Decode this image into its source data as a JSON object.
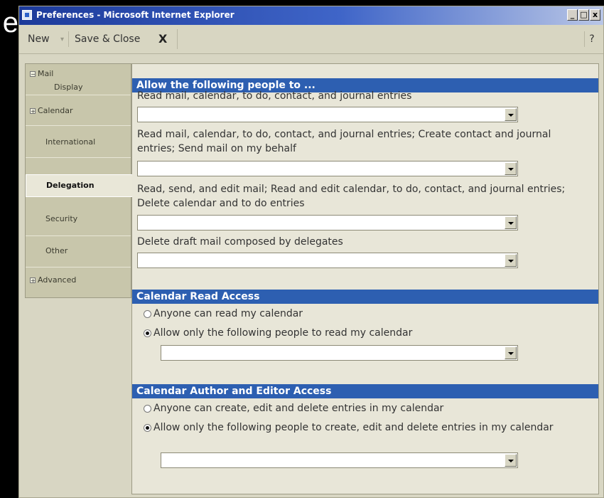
{
  "background_letter": "e",
  "window": {
    "title": "Preferences - Microsoft Internet Explorer",
    "controls": {
      "minimize": "_",
      "maximize": "□",
      "close": "x"
    }
  },
  "toolbar": {
    "new_label": "New",
    "new_arrow": "▾",
    "save_close_label": "Save & Close",
    "close_glyph": "X",
    "help_label": "?"
  },
  "nav": {
    "items": [
      {
        "label": "Mail",
        "toggle": "−"
      },
      {
        "label": "Display"
      },
      {
        "label": "Calendar",
        "toggle": "+"
      },
      {
        "label": "International"
      },
      {
        "label": "Delegation",
        "active": true
      },
      {
        "label": "Security"
      },
      {
        "label": "Other"
      },
      {
        "label": "Advanced",
        "toggle": "+"
      }
    ]
  },
  "delegates": {
    "header": "Allow the following people to ...",
    "perm1": "Read mail, calendar, to do, contact, and journal entries",
    "perm2": "Read mail, calendar, to do, contact, and journal entries; Create contact and journal entries; Send mail on my behalf",
    "perm3": "Read, send, and edit mail; Read and edit calendar, to do, contact, and journal entries; Delete calendar and to do entries",
    "perm4": "Delete draft mail composed by delegates",
    "dropdown1_value": "",
    "dropdown2_value": "",
    "dropdown3_value": "",
    "dropdown4_value": ""
  },
  "calendar_read": {
    "header": "Calendar Read Access",
    "option_anyone": "Anyone can read my calendar",
    "option_only": "Allow only the following people to read my calendar",
    "selected": "option_only",
    "dropdown_value": ""
  },
  "calendar_author": {
    "header": "Calendar Author and Editor Access",
    "option_anyone": "Anyone can create, edit and delete entries in my calendar",
    "option_only": "Allow only the following people to create, edit and delete entries in my calendar",
    "selected": "option_only",
    "dropdown_value": ""
  },
  "colors": {
    "title_bar": "#1c3a9a",
    "section_header": "#2d5fb1",
    "panel": "#e8e6d8",
    "nav_bg": "#c8c6ab"
  }
}
